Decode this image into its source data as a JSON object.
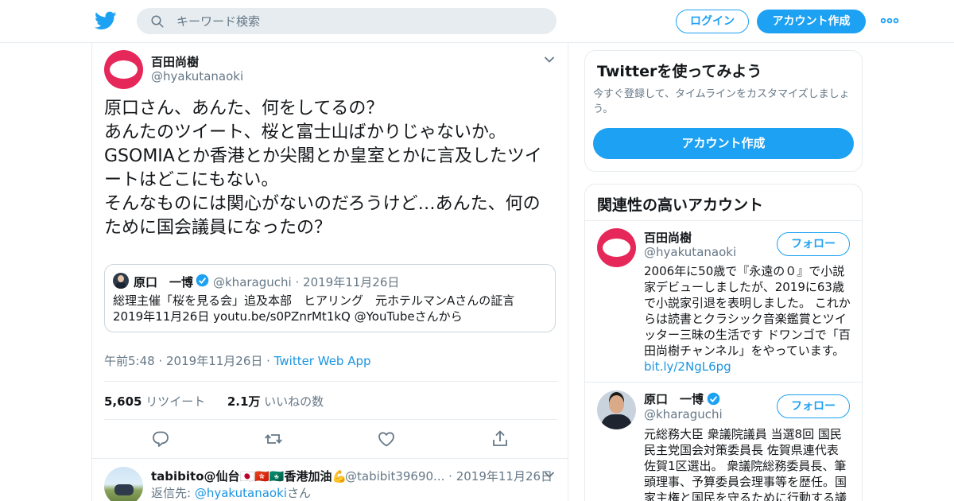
{
  "header": {
    "search_placeholder": "キーワード検索",
    "login_label": "ログイン",
    "signup_label": "アカウント作成"
  },
  "tweet": {
    "author_name": "百田尚樹",
    "author_handle": "@hyakutanaoki",
    "text": "原口さん、あんた、何をしてるの？\nあんたのツイート、桜と富士山ばかりじゃないか。\nGSOMIAとか香港とか尖閣とか皇室とかに言及したツイートはどこにもない。\nそんなものには関心がないのだろうけど…あんた、何のために国会議員になったの？",
    "quote": {
      "author_name": "原口　一博",
      "author_handle": "@kharaguchi",
      "date": "2019年11月26日",
      "text": "総理主催「桜を見る会」追及本部　ヒアリング　元ホテルマンAさんの証言\n2019年11月26日 youtu.be/s0PZnrMt1kQ @YouTubeさんから"
    },
    "time": "午前5:48",
    "date": "2019年11月26日",
    "source": "Twitter Web App",
    "retweets_count": "5,605",
    "retweets_label": "リツイート",
    "likes_count": "2.1万",
    "likes_label": "いいねの数"
  },
  "reply": {
    "author_name": "tabibito@仙台🇯🇵🇭🇰🇲🇴香港加油💪",
    "author_handle": "@tabibit39690...",
    "date": "2019年11月26日",
    "reply_to_prefix": "返信先: ",
    "reply_to_handle": "@hyakutanaoki",
    "reply_to_suffix": "さん"
  },
  "sidebar": {
    "try_card": {
      "title": "Twitterを使ってみよう",
      "description": "今すぐ登録して、タイムラインをカスタマイズしましょう。",
      "button_label": "アカウント作成"
    },
    "related": {
      "title": "関連性の高いアカウント",
      "follow_label": "フォロー",
      "accounts": [
        {
          "name": "百田尚樹",
          "handle": "@hyakutanaoki",
          "bio": "2006年に50歳で『永遠の０』で小説家デビューしましたが、2019に63歳で小説家引退を表明しました。 これからは読書とクラシック音楽鑑賞とツイッター三昧の生活です ドワンゴで「百田尚樹チャンネル」をやっています。",
          "link": "bit.ly/2NgL6pg"
        },
        {
          "name": "原口　一博",
          "handle": "@kharaguchi",
          "bio": "元総務大臣 衆議院議員 当選8回 国民民主党国会対策委員長 佐賀県連代表 佐賀1区選出。 衆議院総務委員長、筆頭理事、予算委員会理事等を歴任。国家主権と国民を守るために行動する議"
        }
      ]
    }
  },
  "colors": {
    "brand_blue": "#1da1f2",
    "link_blue": "#1b95e0",
    "secondary_text": "#657786",
    "border": "#e6ecf0"
  },
  "icons": [
    "twitter-bird-icon",
    "search-icon",
    "more-dots-icon",
    "chevron-down-icon",
    "verified-badge-icon",
    "reply-icon",
    "retweet-icon",
    "like-icon",
    "share-icon"
  ]
}
